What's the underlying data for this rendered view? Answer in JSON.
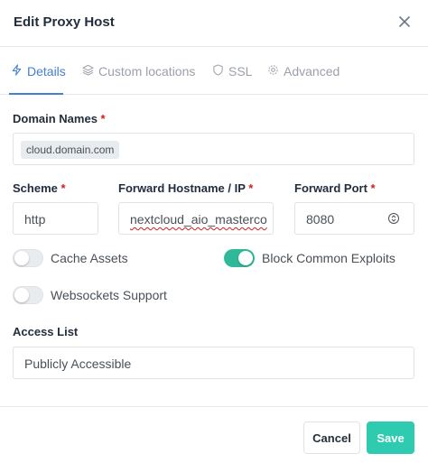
{
  "modal": {
    "title": "Edit Proxy Host",
    "close_icon": "close-icon"
  },
  "tabs": [
    {
      "label": "Details",
      "icon": "lightning-icon",
      "active": true
    },
    {
      "label": "Custom locations",
      "icon": "layers-icon",
      "active": false
    },
    {
      "label": "SSL",
      "icon": "shield-icon",
      "active": false
    },
    {
      "label": "Advanced",
      "icon": "gear-icon",
      "active": false
    }
  ],
  "form": {
    "required_mark": "*",
    "domain_names": {
      "label": "Domain Names",
      "values": [
        "cloud.domain.com"
      ]
    },
    "scheme": {
      "label": "Scheme",
      "value": "http"
    },
    "forward_host": {
      "label": "Forward Hostname / IP",
      "value": "nextcloud_aio_masterco"
    },
    "forward_port": {
      "label": "Forward Port",
      "value": "8080"
    },
    "cache_assets": {
      "label": "Cache Assets",
      "enabled": false
    },
    "block_exploits": {
      "label": "Block Common Exploits",
      "enabled": true
    },
    "websockets": {
      "label": "Websockets Support",
      "enabled": false
    },
    "access_list": {
      "label": "Access List",
      "value": "Publicly Accessible"
    }
  },
  "footer": {
    "cancel_label": "Cancel",
    "save_label": "Save"
  },
  "colors": {
    "accent": "#467fcf",
    "success": "#2fcbb0",
    "toggle_on": "#2fb99a",
    "required": "#cd201f"
  }
}
